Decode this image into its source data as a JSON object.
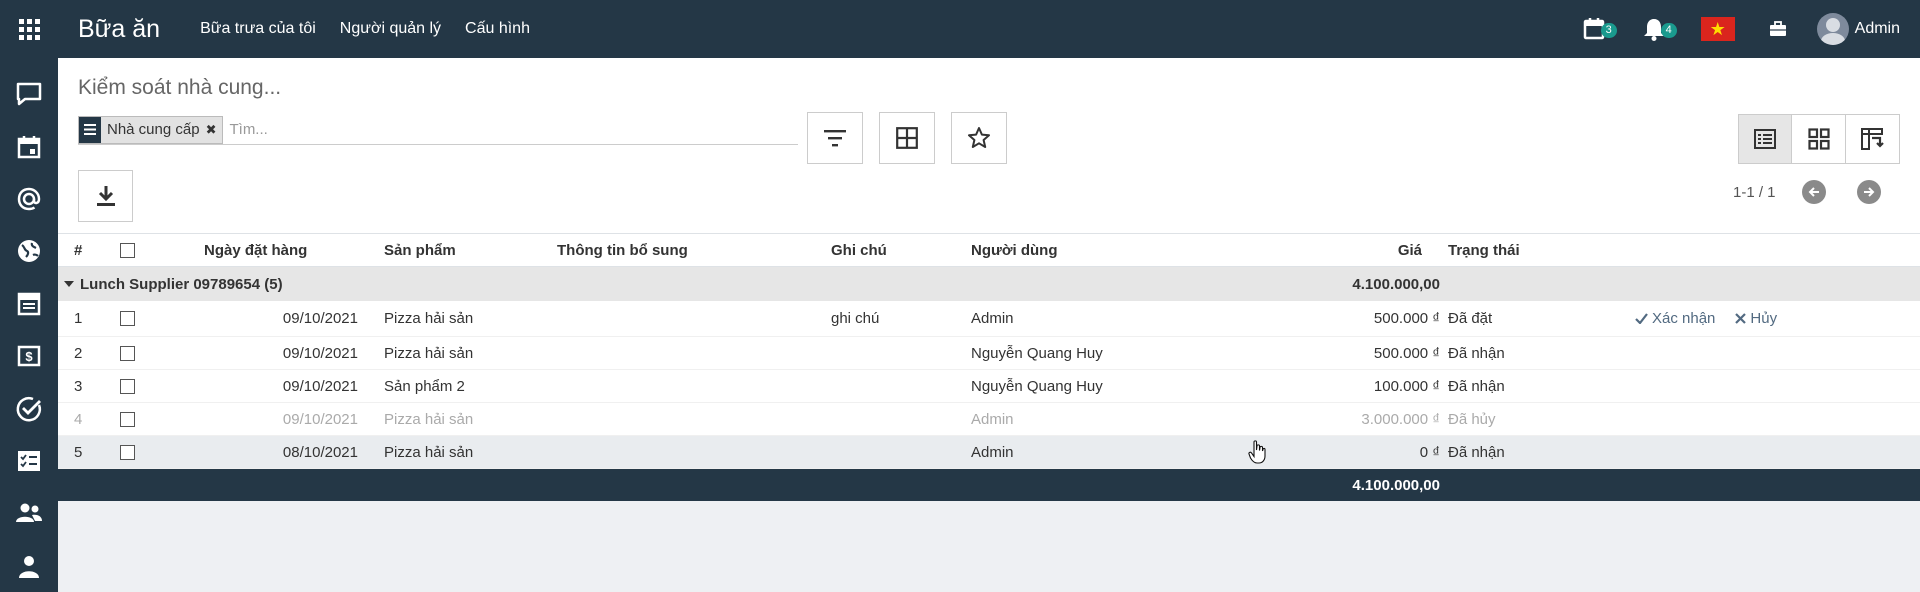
{
  "app": {
    "title": "Bữa ăn",
    "menu": [
      "Bữa trưa của tôi",
      "Người quản lý",
      "Cấu hình"
    ]
  },
  "systray": {
    "activity_count": "3",
    "notification_count": "4",
    "user": "Admin"
  },
  "sidebar_icons": [
    "chat-icon",
    "calendar-icon",
    "at-mention-icon",
    "globe-icon",
    "newspaper-icon",
    "money-icon",
    "check-circle-icon",
    "task-list-icon",
    "users-icon",
    "user-icon"
  ],
  "control_panel": {
    "breadcrumb": "Kiểm soát nhà cung...",
    "facet_label": "Nhà cung cấp",
    "search_placeholder": "Tìm...",
    "pager": "1-1 / 1"
  },
  "table": {
    "headers": {
      "num": "#",
      "date": "Ngày đặt hàng",
      "product": "Sản phẩm",
      "info": "Thông tin bổ sung",
      "note": "Ghi chú",
      "user": "Người dùng",
      "price": "Giá",
      "state": "Trạng thái"
    },
    "group": {
      "label": "Lunch Supplier 09789654 (5)",
      "total": "4.100.000,00"
    },
    "rows": [
      {
        "num": "1",
        "date": "09/10/2021",
        "product": "Pizza hải sản",
        "info": "",
        "note": "ghi chú",
        "user": "Admin",
        "price": "500.000 ₫",
        "state": "Đã đặt",
        "confirm": "Xác nhận",
        "cancel": "Hủy"
      },
      {
        "num": "2",
        "date": "09/10/2021",
        "product": "Pizza hải sản",
        "info": "",
        "note": "",
        "user": "Nguyễn Quang Huy",
        "price": "500.000 ₫",
        "state": "Đã nhận"
      },
      {
        "num": "3",
        "date": "09/10/2021",
        "product": "Sản phẩm 2",
        "info": "",
        "note": "",
        "user": "Nguyễn Quang Huy",
        "price": "100.000 ₫",
        "state": "Đã nhận"
      },
      {
        "num": "4",
        "date": "09/10/2021",
        "product": "Pizza hải sản",
        "info": "",
        "note": "",
        "user": "Admin",
        "price": "3.000.000 ₫",
        "state": "Đã hủy"
      },
      {
        "num": "5",
        "date": "08/10/2021",
        "product": "Pizza hải sản",
        "info": "",
        "note": "",
        "user": "Admin",
        "price": "0 ₫",
        "state": "Đã nhận"
      }
    ],
    "footer_total": "4.100.000,00"
  },
  "colors": {
    "navbar": "#243746",
    "badge": "#1a9a8e",
    "group_bg": "#e6e6e6",
    "muted_text": "#aaaaaa"
  }
}
